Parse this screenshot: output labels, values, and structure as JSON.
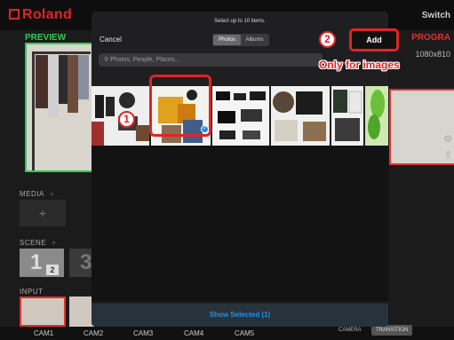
{
  "app": {
    "logo": "Roland",
    "switch_label": "Switch",
    "preview_label": "PREVIEW",
    "program_label": "PROGRA",
    "resolution": "1080x810",
    "sections": {
      "media": "MEDIA",
      "scene": "SCENE",
      "input": "INPUT"
    },
    "scenes": [
      {
        "number": "1",
        "sub": "2",
        "active": true
      },
      {
        "number": "3",
        "active": false
      }
    ],
    "cameras": [
      "CAM1",
      "CAM2",
      "CAM3",
      "CAM4",
      "CAM5"
    ],
    "bottom_tabs": [
      {
        "label": "CAMERA",
        "selected": false
      },
      {
        "label": "TRANSITION",
        "selected": true
      }
    ],
    "plus_glyph": "+"
  },
  "picker": {
    "title": "Select up to 10 items.",
    "cancel_label": "Cancel",
    "tabs": [
      {
        "label": "Photos",
        "selected": true
      },
      {
        "label": "Albums",
        "selected": false
      }
    ],
    "search_placeholder": "Photos, People, Places...",
    "photos": [
      {
        "name": "boots-and-hats",
        "selected": false
      },
      {
        "name": "folded-clothes",
        "selected": true
      },
      {
        "name": "sneakers-and-shoes",
        "selected": false
      },
      {
        "name": "hat-and-knitwear",
        "selected": false
      },
      {
        "name": "shirts-and-sweaters",
        "selected": false
      },
      {
        "name": "green-leaves",
        "selected": false
      }
    ],
    "show_selected_label": "Show Selected (1)"
  },
  "add_label": "Add",
  "annotations": {
    "step1": "1",
    "step2": "2",
    "note": "Only for images",
    "check": "✓"
  },
  "colors": {
    "annotation_red": "#e02424",
    "preview_green": "#2ecc55",
    "link_blue": "#2b8fe6"
  }
}
